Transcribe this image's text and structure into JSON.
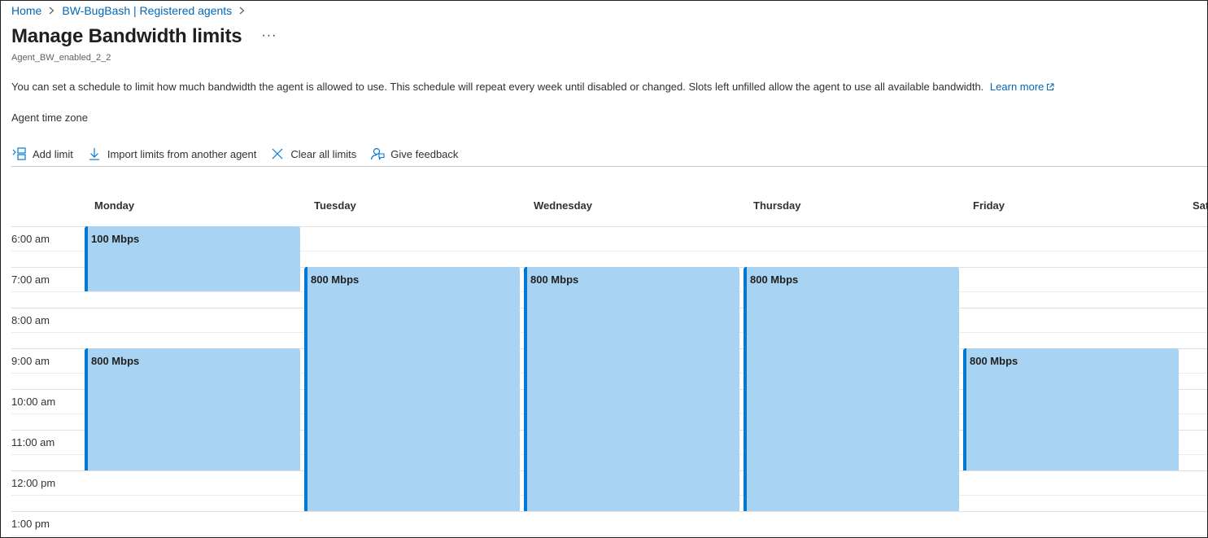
{
  "breadcrumb": {
    "items": [
      {
        "label": "Home"
      },
      {
        "label": "BW-BugBash | Registered agents"
      }
    ]
  },
  "page": {
    "title": "Manage Bandwidth limits",
    "more": "···",
    "subtitle": "Agent_BW_enabled_2_2",
    "description": "You can set a schedule to limit how much bandwidth the agent is allowed to use. This schedule will repeat every week until disabled or changed. Slots left unfilled allow the agent to use all available bandwidth.",
    "learn_more": "Learn more",
    "time_zone_label": "Agent time zone"
  },
  "toolbar": {
    "add_limit": "Add limit",
    "import_limits": "Import limits from another agent",
    "clear_all": "Clear all limits",
    "give_feedback": "Give feedback"
  },
  "calendar": {
    "days": [
      "Monday",
      "Tuesday",
      "Wednesday",
      "Thursday",
      "Friday",
      "Sat"
    ],
    "times": [
      "6:00 am",
      "7:00 am",
      "8:00 am",
      "9:00 am",
      "10:00 am",
      "11:00 am",
      "12:00 pm",
      "1:00 pm"
    ],
    "blocks": [
      {
        "day": 0,
        "start": 0,
        "end": 1.6,
        "label": "100 Mbps"
      },
      {
        "day": 0,
        "start": 3,
        "end": 6,
        "label": "800 Mbps"
      },
      {
        "day": 1,
        "start": 1,
        "end": 7,
        "label": "800 Mbps"
      },
      {
        "day": 2,
        "start": 1,
        "end": 7,
        "label": "800 Mbps"
      },
      {
        "day": 3,
        "start": 1,
        "end": 7,
        "label": "800 Mbps"
      },
      {
        "day": 4,
        "start": 3,
        "end": 6,
        "label": "800 Mbps"
      }
    ]
  },
  "colors": {
    "accent": "#0078d4",
    "block_fill": "#a9d3f2",
    "link": "#0067b8"
  }
}
